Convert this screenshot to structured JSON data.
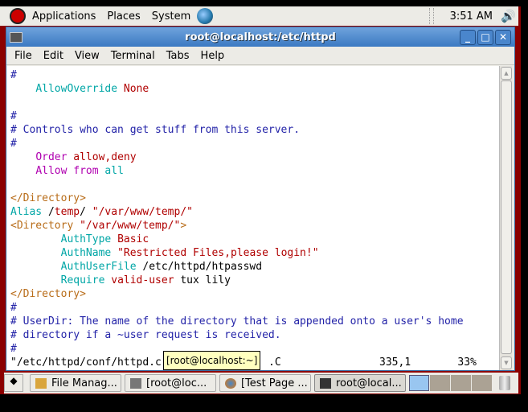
{
  "panel": {
    "menus": [
      "Applications",
      "Places",
      "System"
    ],
    "clock": "3:51 AM"
  },
  "window": {
    "title": "root@localhost:/etc/httpd",
    "menu": [
      "File",
      "Edit",
      "View",
      "Terminal",
      "Tabs",
      "Help"
    ]
  },
  "colors": {
    "c": "#2323a8",
    "k": "#00a6a6",
    "v": "#b00000",
    "m": "#b000b0",
    "d": "#b86c18",
    "t": "#000000"
  },
  "terminal": {
    "lines": [
      [
        [
          "#",
          "c"
        ]
      ],
      [
        [
          "    ",
          "t"
        ],
        [
          "AllowOverride",
          "k"
        ],
        [
          " ",
          "t"
        ],
        [
          "None",
          "v"
        ]
      ],
      [],
      [
        [
          "#",
          "c"
        ]
      ],
      [
        [
          "# Controls who can get stuff from this server.",
          "c"
        ]
      ],
      [
        [
          "#",
          "c"
        ]
      ],
      [
        [
          "    ",
          "t"
        ],
        [
          "Order",
          "m"
        ],
        [
          " ",
          "t"
        ],
        [
          "allow,deny",
          "v"
        ]
      ],
      [
        [
          "    ",
          "t"
        ],
        [
          "Allow",
          "m"
        ],
        [
          " ",
          "t"
        ],
        [
          "from",
          "m"
        ],
        [
          " ",
          "t"
        ],
        [
          "all",
          "k"
        ]
      ],
      [],
      [
        [
          "</Directory>",
          "d"
        ]
      ],
      [
        [
          "Alias",
          "k"
        ],
        [
          " /",
          "t"
        ],
        [
          "temp",
          "v"
        ],
        [
          "/ ",
          "t"
        ],
        [
          "\"/var/www/temp/\"",
          "v"
        ]
      ],
      [
        [
          "<Directory ",
          "d"
        ],
        [
          "\"/var/www/temp/\"",
          "v"
        ],
        [
          ">",
          "d"
        ]
      ],
      [
        [
          "        ",
          "t"
        ],
        [
          "AuthType",
          "k"
        ],
        [
          " ",
          "t"
        ],
        [
          "Basic",
          "v"
        ]
      ],
      [
        [
          "        ",
          "t"
        ],
        [
          "AuthName",
          "k"
        ],
        [
          " ",
          "t"
        ],
        [
          "\"Restricted Files,please login!\"",
          "v"
        ]
      ],
      [
        [
          "        ",
          "t"
        ],
        [
          "AuthUserFile",
          "k"
        ],
        [
          " /etc/httpd/htpasswd",
          "t"
        ]
      ],
      [
        [
          "        ",
          "t"
        ],
        [
          "Require",
          "k"
        ],
        [
          " ",
          "t"
        ],
        [
          "valid-user",
          "v"
        ],
        [
          " tux lily",
          "t"
        ]
      ],
      [
        [
          "</Directory>",
          "d"
        ]
      ],
      [
        [
          "#",
          "c"
        ]
      ],
      [
        [
          "# UserDir: The name of the directory that is appended onto a user's home",
          "c"
        ]
      ],
      [
        [
          "# directory if a ~user request is received.",
          "c"
        ]
      ],
      [
        [
          "#",
          "c"
        ]
      ],
      [
        [
          "\"/etc/httpd/conf/httpd.c",
          "t"
        ],
        [
          "                       ",
          "t"
        ],
        [
          ".C                     335,1          33%",
          "t"
        ]
      ]
    ]
  },
  "tooltip": "[root@localhost:~]",
  "taskbar": {
    "items": [
      {
        "label": "File Manag...",
        "icon": "folder-icon"
      },
      {
        "label": "[root@loc...",
        "icon": "terminal-icon"
      },
      {
        "label": "[Test Page ...",
        "icon": "firefox-icon"
      },
      {
        "label": "root@local...",
        "icon": "terminal-icon",
        "active": true
      }
    ]
  }
}
